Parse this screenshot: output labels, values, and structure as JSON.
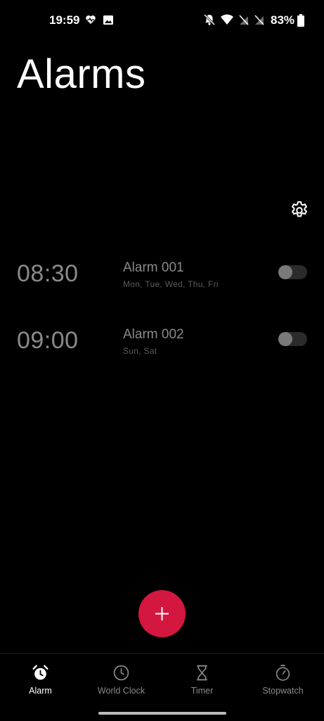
{
  "status_bar": {
    "time": "19:59",
    "battery": "83%",
    "left_icons": [
      "heart-pulse-icon",
      "image-icon"
    ],
    "right_icons": [
      "bell-off-icon",
      "wifi-icon",
      "no-sim-icon",
      "no-sim-icon",
      "battery-icon"
    ]
  },
  "header": {
    "title": "Alarms"
  },
  "alarms": [
    {
      "time": "08:30",
      "name": "Alarm 001",
      "days": "Mon,  Tue,  Wed,  Thu,  Fri",
      "enabled": false
    },
    {
      "time": "09:00",
      "name": "Alarm 002",
      "days": "Sun,  Sat",
      "enabled": false
    }
  ],
  "colors": {
    "background": "#000000",
    "accent": "#d4173f",
    "muted_text": "#8a8a8a"
  },
  "nav": {
    "items": [
      {
        "label": "Alarm",
        "icon": "alarm-clock-icon",
        "active": true
      },
      {
        "label": "World Clock",
        "icon": "clock-icon",
        "active": false
      },
      {
        "label": "Timer",
        "icon": "hourglass-icon",
        "active": false
      },
      {
        "label": "Stopwatch",
        "icon": "stopwatch-icon",
        "active": false
      }
    ]
  }
}
